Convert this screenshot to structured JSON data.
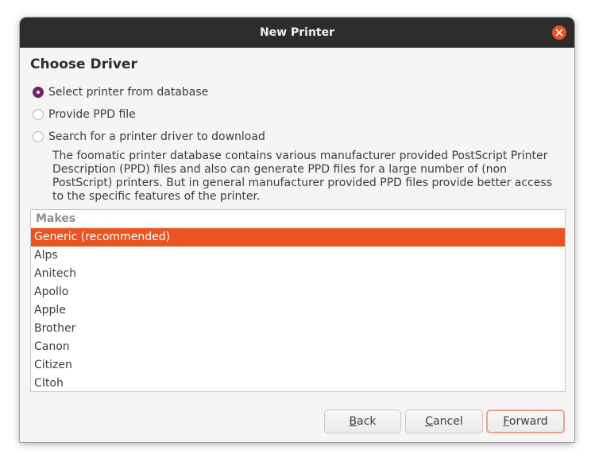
{
  "window": {
    "title": "New Printer"
  },
  "heading": "Choose Driver",
  "options": [
    {
      "label": "Select printer from database",
      "checked": true
    },
    {
      "label": "Provide PPD file",
      "checked": false
    },
    {
      "label": "Search for a printer driver to download",
      "checked": false
    }
  ],
  "description": "The foomatic printer database contains various manufacturer provided PostScript Printer Description (PPD) files and also can generate PPD files for a large number of (non PostScript) printers. But in general manufacturer provided PPD files provide better access to the specific features of the printer.",
  "makes": {
    "header": "Makes",
    "items": [
      "Generic (recommended)",
      "Alps",
      "Anitech",
      "Apollo",
      "Apple",
      "Brother",
      "Canon",
      "Citizen",
      "CItoh"
    ],
    "selected": "Generic (recommended)"
  },
  "buttons": {
    "back": {
      "mnemonic": "B",
      "rest": "ack"
    },
    "cancel": {
      "mnemonic": "C",
      "rest": "ancel"
    },
    "forward": {
      "mnemonic": "F",
      "rest": "orward"
    }
  },
  "icons": {
    "close": "close-icon"
  },
  "colors": {
    "accent": "#e95420",
    "radio": "#77216f",
    "titlebar": "#2c2c2c"
  }
}
